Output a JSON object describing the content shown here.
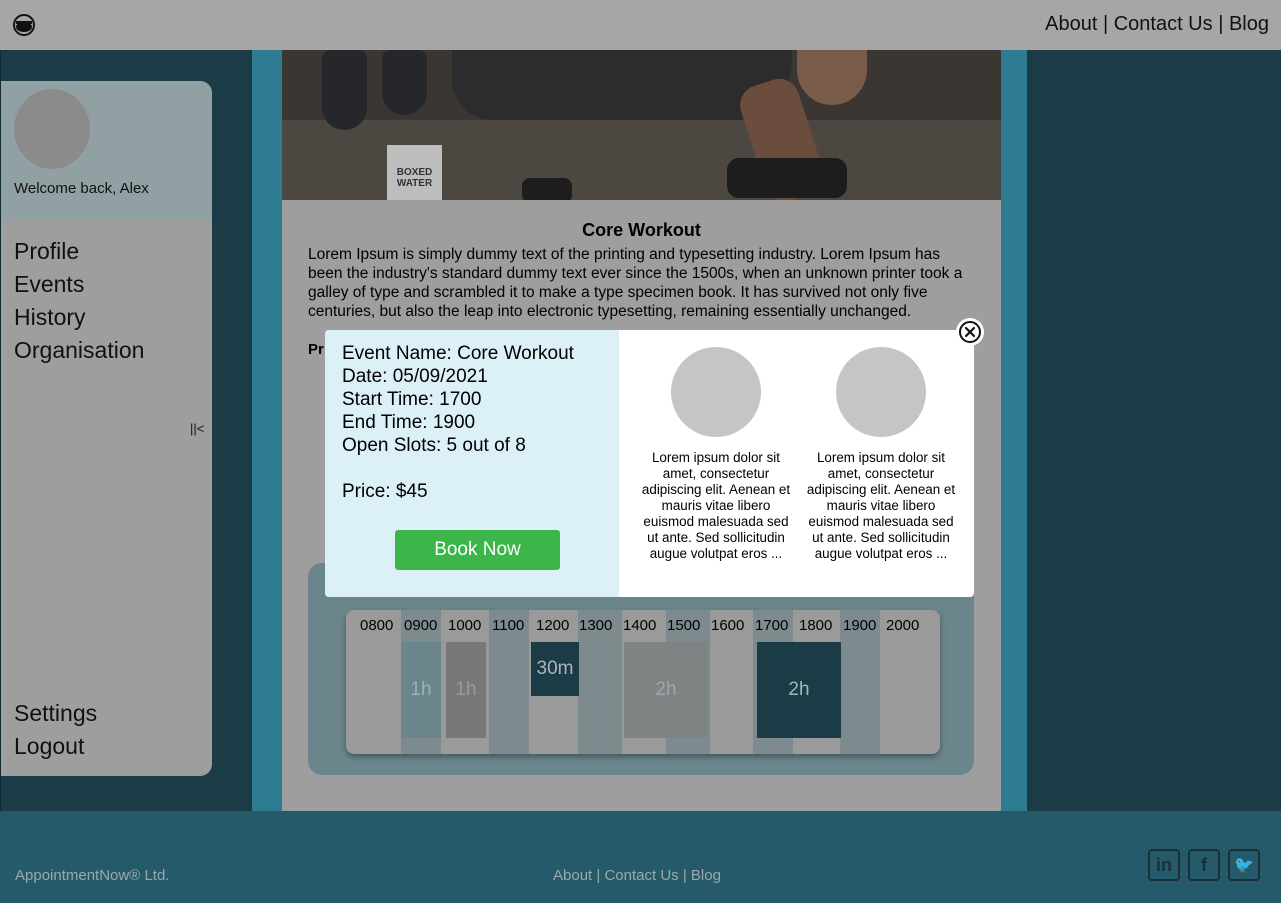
{
  "header": {
    "nav": [
      {
        "label": "About"
      },
      {
        "label": "Contact Us"
      },
      {
        "label": "Blog"
      }
    ],
    "separator": " | "
  },
  "hero": {
    "carton_text": "BOXED WATER"
  },
  "sidebar": {
    "welcome": "Welcome back, Alex",
    "items": [
      {
        "label": "Profile"
      },
      {
        "label": "Events"
      },
      {
        "label": "History"
      },
      {
        "label": "Organisation"
      }
    ],
    "bottom_items": [
      {
        "label": "Settings"
      },
      {
        "label": "Logout"
      }
    ],
    "collapse_label": "||<"
  },
  "event": {
    "title": "Core Workout",
    "description": "Lorem Ipsum is simply dummy text of the printing and typesetting industry. Lorem Ipsum has been the industry's standard dummy text ever since the 1500s, when an unknown printer took a galley of type and scrambled it to make a type specimen book. It has survived not only five centuries, but also the leap into electronic typesetting, remaining essentially unchanged.",
    "price_label_partial": "Pr"
  },
  "schedule": {
    "ticks": [
      "0800",
      "0900",
      "1000",
      "1100",
      "1200",
      "1300",
      "1400",
      "1500",
      "1600",
      "1700",
      "1800",
      "1900",
      "2000"
    ],
    "blocks": [
      {
        "label": "1h",
        "color": "#6b858c",
        "text_color": "#9db0b4"
      },
      {
        "label": "1h",
        "color": "#787878",
        "text_color": "#9a9a9a"
      },
      {
        "label": "30m",
        "color": "#1b3b46",
        "text_color": "#a9b6b9"
      },
      {
        "label": "2h",
        "color": "#7e8384",
        "text_color": "#a2a8aa"
      },
      {
        "label": "2h",
        "color": "#1b3b46",
        "text_color": "#a9b6b9"
      }
    ]
  },
  "modal": {
    "event_name": "Event Name: Core Workout",
    "date": "Date: 05/09/2021",
    "start_time": "Start Time: 1700",
    "end_time": "End Time: 1900",
    "open_slots": "Open Slots: 5 out of 8",
    "price": "Price: $45",
    "book_label": "Book Now",
    "trainers": [
      {
        "bio": "Lorem ipsum dolor sit amet, consectetur adipiscing elit. Aenean et mauris vitae libero euismod malesuada sed ut ante. Sed sollicitudin augue volutpat eros ..."
      },
      {
        "bio": "Lorem ipsum dolor sit amet, consectetur adipiscing elit. Aenean et mauris vitae libero euismod malesuada sed ut ante. Sed sollicitudin augue volutpat eros ..."
      }
    ],
    "close_icon": "close-icon"
  },
  "footer": {
    "copyright": "AppointmentNow® Ltd.",
    "nav": [
      {
        "label": "About"
      },
      {
        "label": "Contact Us"
      },
      {
        "label": "Blog"
      }
    ],
    "social": [
      {
        "name": "linkedin-icon",
        "glyph": "in"
      },
      {
        "name": "facebook-icon",
        "glyph": "f"
      },
      {
        "name": "twitter-icon",
        "glyph": "🐦"
      }
    ]
  }
}
